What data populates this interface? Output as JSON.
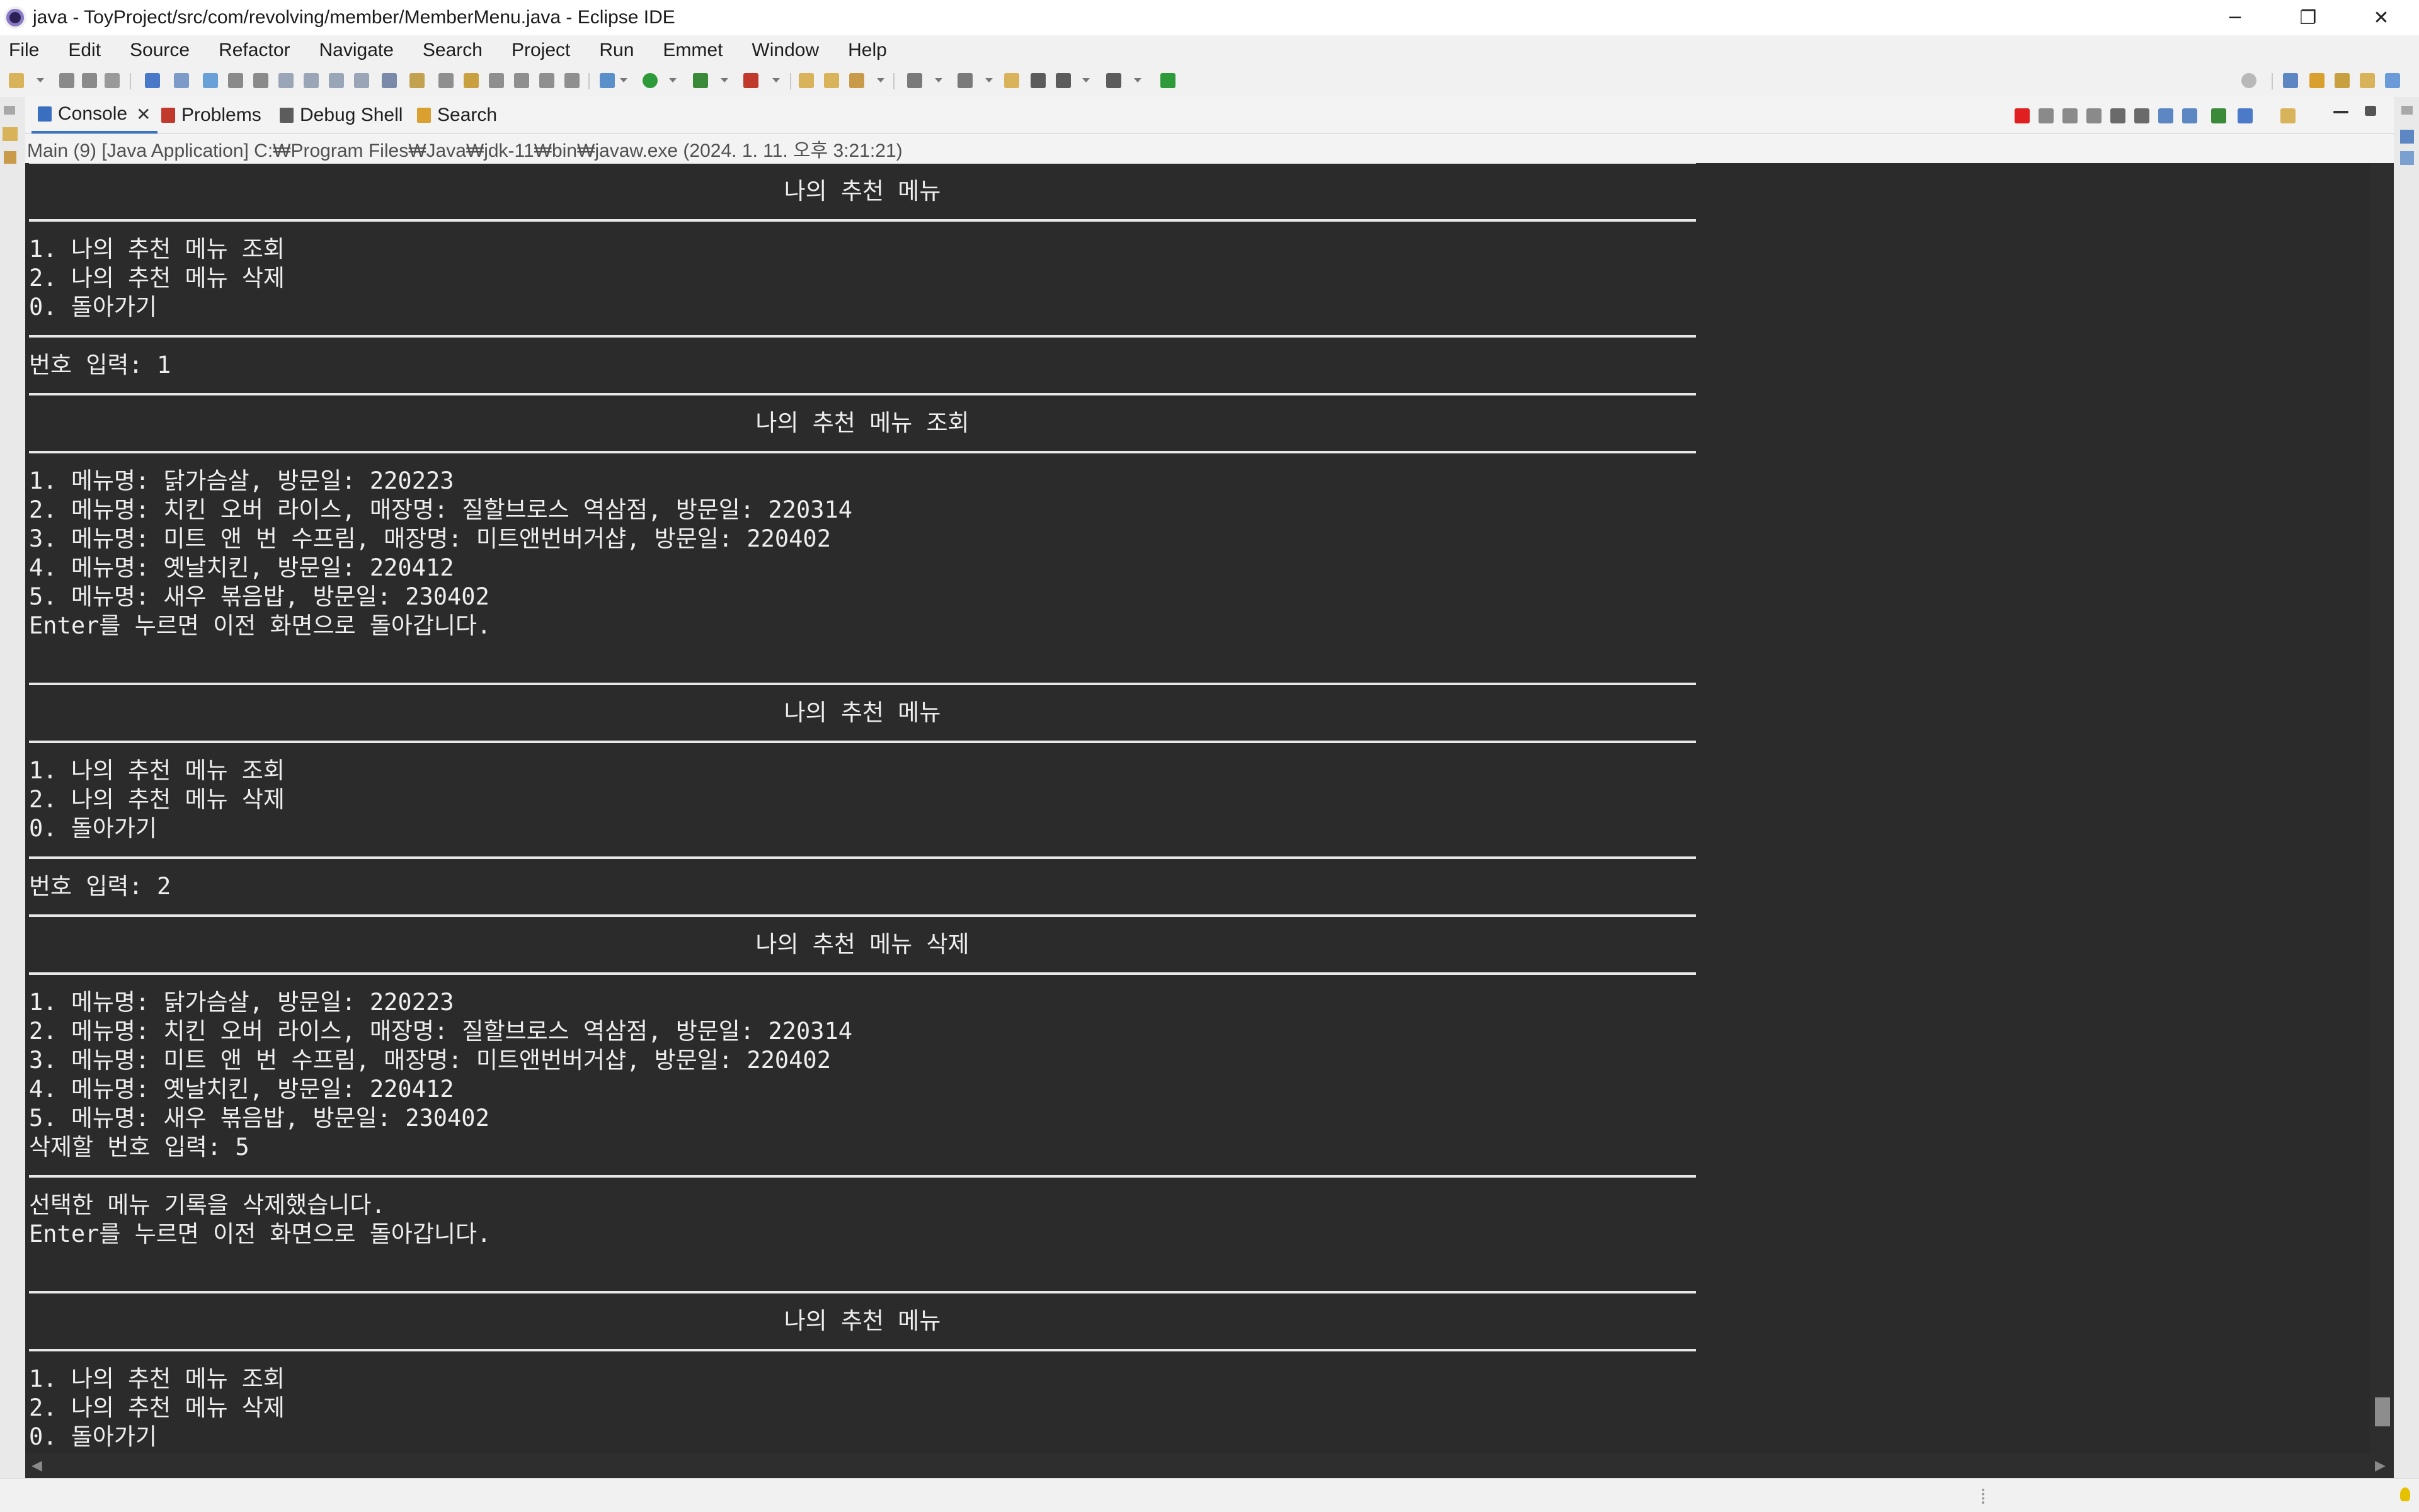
{
  "window": {
    "title": "java - ToyProject/src/com/revolving/member/MemberMenu.java - Eclipse IDE",
    "controls": {
      "minimize": "─",
      "maximize": "❐",
      "close": "✕"
    }
  },
  "menubar": [
    "File",
    "Edit",
    "Source",
    "Refactor",
    "Navigate",
    "Search",
    "Project",
    "Run",
    "Emmet",
    "Window",
    "Help"
  ],
  "views": {
    "tabs": [
      {
        "label": "Console",
        "active": true,
        "icon": "console-icon"
      },
      {
        "label": "Problems",
        "active": false,
        "icon": "problems-icon"
      },
      {
        "label": "Debug Shell",
        "active": false,
        "icon": "debug-shell-icon"
      },
      {
        "label": "Search",
        "active": false,
        "icon": "search-icon"
      }
    ],
    "close_glyph": "✕"
  },
  "console": {
    "description": "Main (9) [Java Application] C:₩Program Files₩Java₩jdk-11₩bin₩javaw.exe  (2024. 1. 11. 오후 3:21:21)",
    "lines": [
      {
        "type": "rule"
      },
      {
        "type": "title",
        "text": "나의 추천 메뉴"
      },
      {
        "type": "rule"
      },
      {
        "type": "text",
        "text": "1. 나의 추천 메뉴 조회"
      },
      {
        "type": "text",
        "text": "2. 나의 추천 메뉴 삭제"
      },
      {
        "type": "text",
        "text": "0. 돌아가기"
      },
      {
        "type": "rule"
      },
      {
        "type": "text",
        "text": "번호 입력: 1"
      },
      {
        "type": "rule"
      },
      {
        "type": "title",
        "text": "나의 추천 메뉴 조회"
      },
      {
        "type": "rule"
      },
      {
        "type": "text",
        "text": "1. 메뉴명: 닭가슴살, 방문일: 220223"
      },
      {
        "type": "text",
        "text": "2. 메뉴명: 치킨 오버 라이스, 매장명: 질할브로스 역삼점, 방문일: 220314"
      },
      {
        "type": "text",
        "text": "3. 메뉴명: 미트 앤 번 수프림, 매장명: 미트앤번버거샵, 방문일: 220402"
      },
      {
        "type": "text",
        "text": "4. 메뉴명: 옛날치킨, 방문일: 220412"
      },
      {
        "type": "text",
        "text": "5. 메뉴명: 새우 볶음밥, 방문일: 230402"
      },
      {
        "type": "text",
        "text": "Enter를 누르면 이전 화면으로 돌아갑니다."
      },
      {
        "type": "text",
        "text": ""
      },
      {
        "type": "rule"
      },
      {
        "type": "title",
        "text": "나의 추천 메뉴"
      },
      {
        "type": "rule"
      },
      {
        "type": "text",
        "text": "1. 나의 추천 메뉴 조회"
      },
      {
        "type": "text",
        "text": "2. 나의 추천 메뉴 삭제"
      },
      {
        "type": "text",
        "text": "0. 돌아가기"
      },
      {
        "type": "rule"
      },
      {
        "type": "text",
        "text": "번호 입력: 2"
      },
      {
        "type": "rule"
      },
      {
        "type": "title",
        "text": "나의 추천 메뉴 삭제"
      },
      {
        "type": "rule"
      },
      {
        "type": "text",
        "text": "1. 메뉴명: 닭가슴살, 방문일: 220223"
      },
      {
        "type": "text",
        "text": "2. 메뉴명: 치킨 오버 라이스, 매장명: 질할브로스 역삼점, 방문일: 220314"
      },
      {
        "type": "text",
        "text": "3. 메뉴명: 미트 앤 번 수프림, 매장명: 미트앤번버거샵, 방문일: 220402"
      },
      {
        "type": "text",
        "text": "4. 메뉴명: 옛날치킨, 방문일: 220412"
      },
      {
        "type": "text",
        "text": "5. 메뉴명: 새우 볶음밥, 방문일: 230402"
      },
      {
        "type": "text",
        "text": "삭제할 번호 입력: 5"
      },
      {
        "type": "rule"
      },
      {
        "type": "text",
        "text": "선택한 메뉴 기록을 삭제했습니다."
      },
      {
        "type": "text",
        "text": "Enter를 누르면 이전 화면으로 돌아갑니다."
      },
      {
        "type": "text",
        "text": ""
      },
      {
        "type": "rule"
      },
      {
        "type": "title",
        "text": "나의 추천 메뉴"
      },
      {
        "type": "rule"
      },
      {
        "type": "text",
        "text": "1. 나의 추천 메뉴 조회"
      },
      {
        "type": "text",
        "text": "2. 나의 추천 메뉴 삭제"
      },
      {
        "type": "text",
        "text": "0. 돌아가기"
      }
    ]
  },
  "colors": {
    "console_bg": "#2b2b2b",
    "console_text": "#eeeeee",
    "active_tab_accent": "#3a73c9",
    "terminate_red": "#e02020"
  }
}
